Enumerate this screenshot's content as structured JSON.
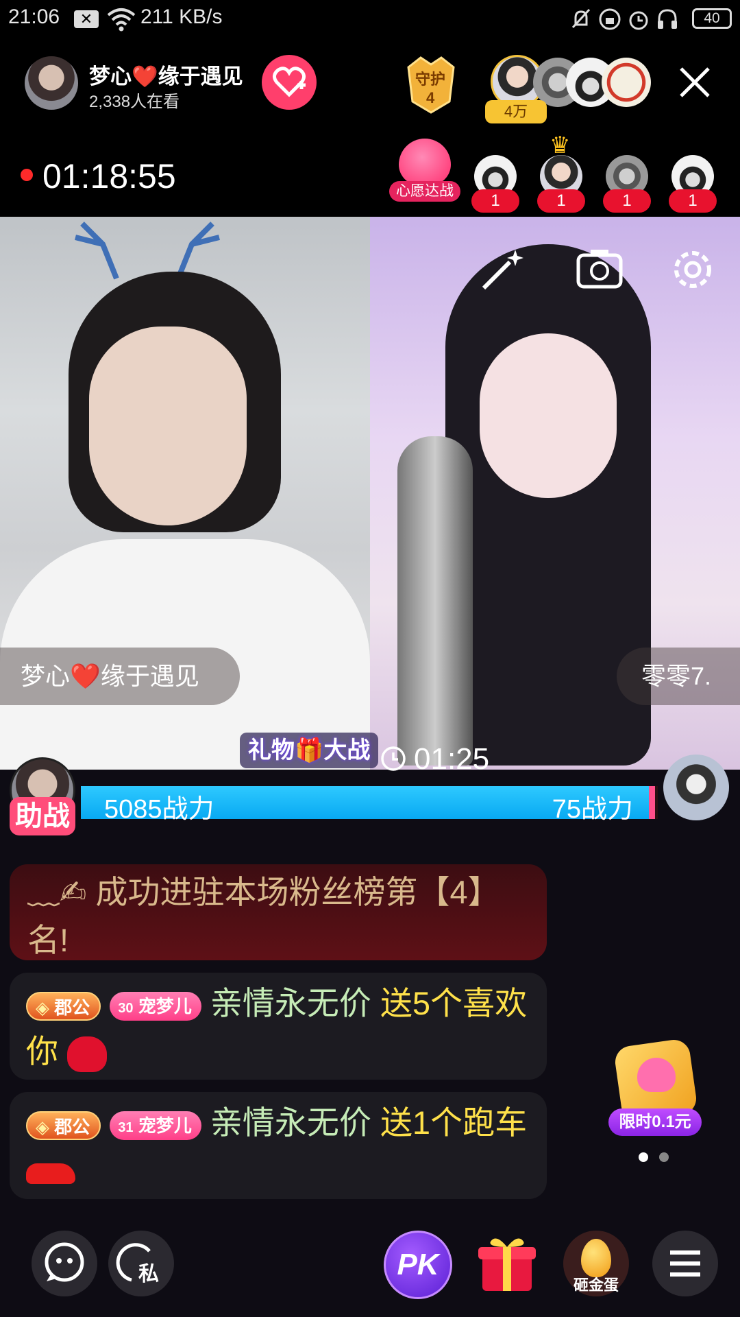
{
  "status_bar": {
    "time": "21:06",
    "speed": "211 KB/s",
    "battery": "40"
  },
  "host": {
    "name": "梦心❤️缘于遇见",
    "viewers": "2,338人在看"
  },
  "guard": {
    "label": "守护",
    "count": "4"
  },
  "top_fans": {
    "count": "4万"
  },
  "live_timer": "01:18:55",
  "wish_battle_label": "心愿达战",
  "supporters": {
    "counts": [
      "1",
      "1",
      "1",
      "1"
    ]
  },
  "video_left": {
    "name": "梦心❤️缘于遇见"
  },
  "video_right": {
    "name": "零零7."
  },
  "battle": {
    "title": "礼物🎁大战",
    "timer": "01:25",
    "left_score": "5085战力",
    "right_score": "75战力",
    "help_label": "助战",
    "left_share": 0.985
  },
  "chat": [
    {
      "type": "system",
      "icon": "﹏✍",
      "text": "成功进驻本场粉丝榜第【4】名!"
    },
    {
      "type": "gift",
      "rank": "郡公",
      "fan_level": "30",
      "fan_club": "宠梦儿",
      "user": "亲情永无价",
      "action": "送5个喜欢你",
      "gift_icon": "love-heart"
    },
    {
      "type": "gift",
      "rank": "郡公",
      "fan_level": "31",
      "fan_club": "宠梦儿",
      "user": "亲情永无价",
      "action": "送1个跑车",
      "gift_icon": "sports-car"
    }
  ],
  "promo": {
    "label": "限时0.1元"
  },
  "bottom": {
    "private_label": "私",
    "pk_label": "PK",
    "egg_label": "砸金蛋"
  },
  "colors": {
    "follow_button": "#ff3f6c",
    "battle_blue": "#10b2f5",
    "battle_pink": "#ff4f8b",
    "gift_yellow": "#ffe14a"
  }
}
